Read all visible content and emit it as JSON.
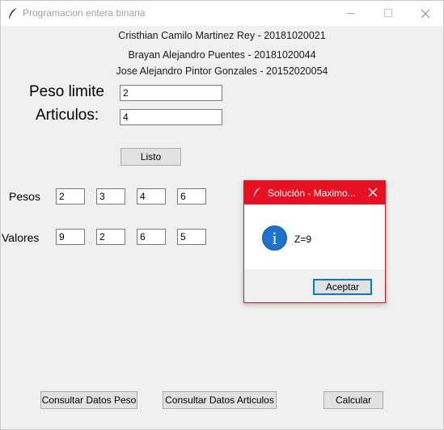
{
  "window": {
    "title": "Programacion entera binaria",
    "icon": "feather-icon"
  },
  "authors": [
    "Cristhian Camilo Martinez Rey - 20181020021",
    "Brayan Alejandro Puentes - 20181020044",
    "Jose Alejandro Pintor Gonzales - 20152020054"
  ],
  "form": {
    "peso_label": "Peso limite",
    "peso_value": "2",
    "articulos_label": "Articulos:",
    "articulos_value": "4",
    "listo_button": "Listo"
  },
  "grid": {
    "pesos_label": "Pesos",
    "pesos": [
      "2",
      "3",
      "4",
      "6"
    ],
    "valores_label": "Valores",
    "valores": [
      "9",
      "2",
      "6",
      "5"
    ]
  },
  "footer": {
    "consultar_peso": "Consultar Datos Peso",
    "consultar_articulos": "Consultar Datos Articulos",
    "calcular": "Calcular"
  },
  "dialog": {
    "title": "Solución - Maximo...",
    "message": "Z=9",
    "ok_button": "Aceptar",
    "icon": "info-icon",
    "accent_color": "#e81123"
  }
}
